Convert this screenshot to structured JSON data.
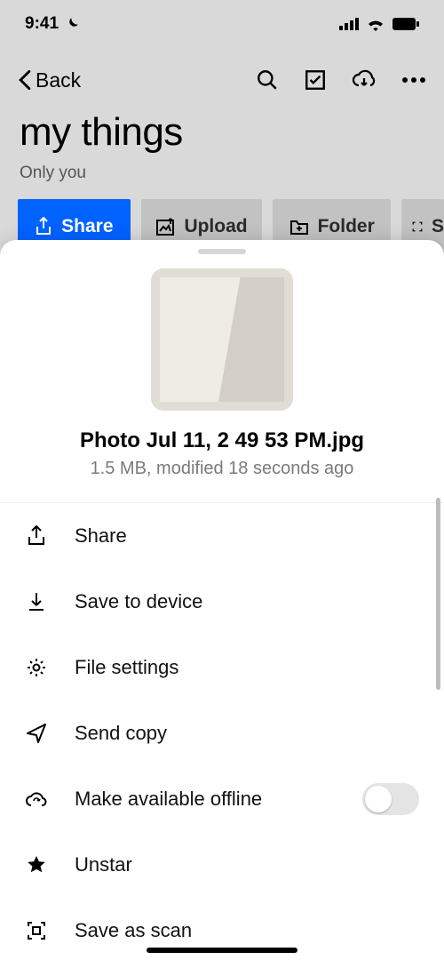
{
  "status": {
    "time": "9:41"
  },
  "nav": {
    "back": "Back"
  },
  "page": {
    "title": "my things",
    "subtitle": "Only you"
  },
  "chips": {
    "share": "Share",
    "upload": "Upload",
    "folder": "Folder",
    "scan": "S"
  },
  "file": {
    "name": "Photo Jul 11, 2 49 53 PM.jpg",
    "meta": "1.5 MB, modified 18 seconds ago"
  },
  "menu": {
    "share": "Share",
    "save": "Save to device",
    "settings": "File settings",
    "send": "Send copy",
    "offline": "Make available offline",
    "unstar": "Unstar",
    "scan": "Save as scan"
  }
}
